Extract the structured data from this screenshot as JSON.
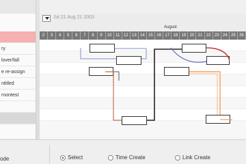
{
  "header": {
    "date_label": "Jul 21 Aug 21 2003",
    "week_label": "August",
    "days": [
      "2",
      "3",
      "4",
      "5",
      "6",
      "7",
      "8",
      "9",
      "10",
      "11",
      "12",
      "13",
      "14",
      "15",
      "16",
      "17",
      "18",
      "19",
      "20",
      "21",
      "22",
      "23",
      "24",
      "25",
      "26"
    ]
  },
  "tasks": [
    {
      "label": "",
      "selected": true
    },
    {
      "label": "ry"
    },
    {
      "label": "lover/fall"
    },
    {
      "label": "e re-assign"
    },
    {
      "label": "ntitled"
    },
    {
      "label": "rnontest"
    },
    {
      "label": ""
    },
    {
      "label": ""
    },
    {
      "label": "",
      "selected_gray": true
    }
  ],
  "bottom": {
    "mode_label": "ode",
    "options": [
      {
        "label": "Select",
        "checked": true
      },
      {
        "label": "Time Create",
        "checked": false
      },
      {
        "label": "Link Create",
        "checked": false
      }
    ]
  },
  "colors": {
    "selection_row": "#f4a0a0",
    "link_blue": "#8090c8",
    "link_orange": "#f0a060",
    "link_red": "#d03030",
    "link_dark": "#222222",
    "link_brown": "#c07050"
  }
}
